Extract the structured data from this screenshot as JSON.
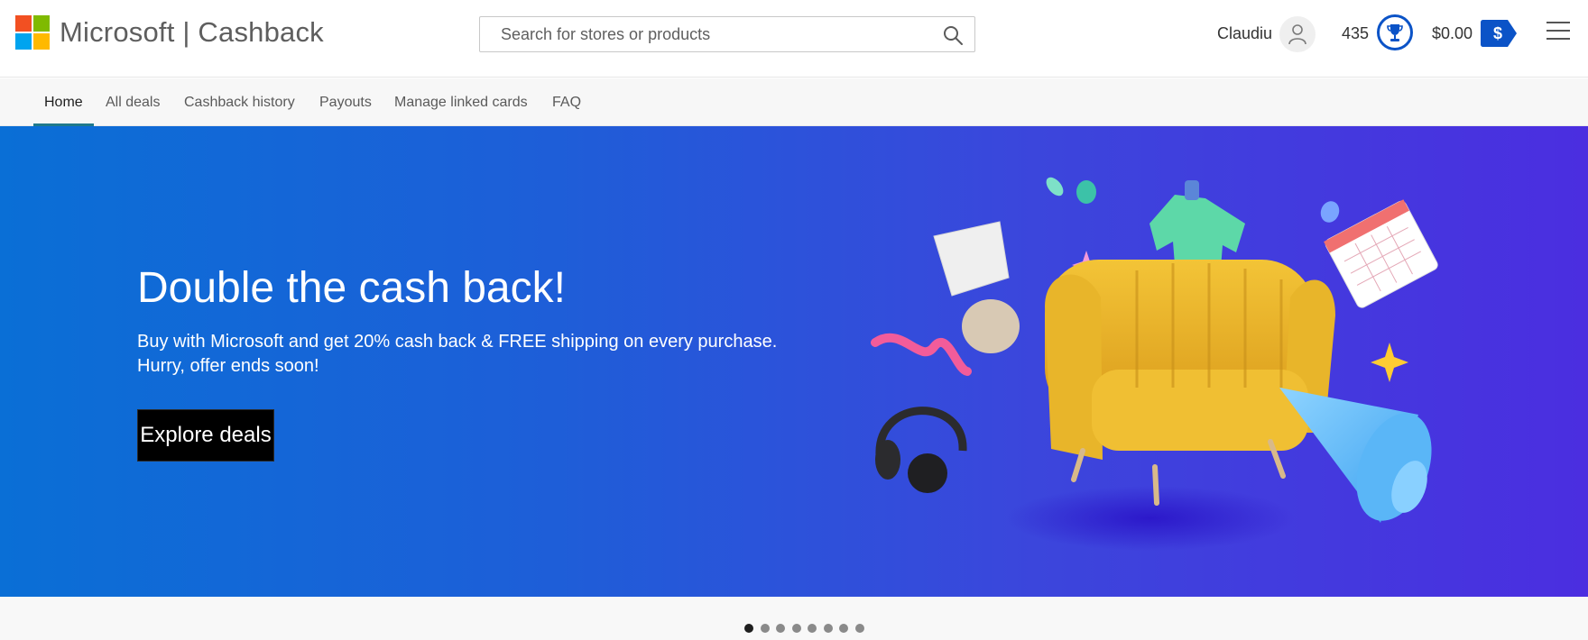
{
  "header": {
    "brand": "Microsoft | Cashback",
    "search_placeholder": "Search for stores or products",
    "user_name": "Claudiu",
    "points": "435",
    "balance": "$0.00",
    "cash_symbol": "$"
  },
  "subnav": {
    "tabs": [
      {
        "label": "Home",
        "active": true
      },
      {
        "label": "All deals"
      },
      {
        "label": "Cashback history"
      },
      {
        "label": "Payouts"
      },
      {
        "label": "Manage linked cards"
      },
      {
        "label": "FAQ"
      }
    ]
  },
  "hero": {
    "title": "Double the cash back!",
    "description_line1": "Buy with Microsoft and get 20% cash back & FREE shipping on every purchase.",
    "description_line2": "Hurry, offer ends soon!",
    "button_label": "Explore deals"
  },
  "carousel": {
    "slide_count": 8,
    "active_index": 0
  },
  "icons": {
    "search": "search-icon",
    "avatar": "person-icon",
    "rewards": "trophy-icon",
    "cash": "dollar-tag-icon",
    "menu": "hamburger-menu-icon"
  },
  "colors": {
    "logo_red": "#f25022",
    "logo_green": "#7fba00",
    "logo_blue": "#00a4ef",
    "logo_yellow": "#ffb900",
    "accent_blue": "#0b53c7",
    "tab_underline": "#1f7a8c",
    "hero_gradient_start": "#0a6fd6",
    "hero_gradient_end": "#4b2ee0"
  }
}
